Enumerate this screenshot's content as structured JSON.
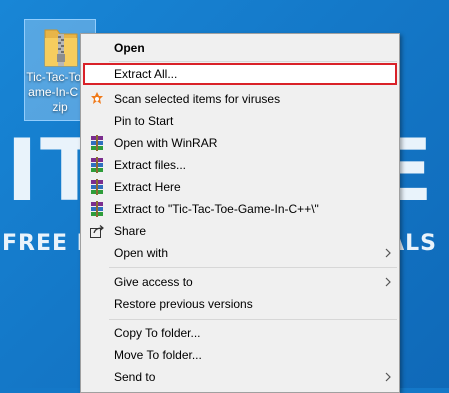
{
  "desktop": {
    "wallpaper_big_left": "IT S",
    "wallpaper_big_right": "E",
    "wallpaper_small_left": "FREE PRO",
    "wallpaper_small_right": "IALS"
  },
  "file": {
    "name": "Tic-Tac-Toe-Game-In-C++.zip",
    "label_visible": "Tic-Tac-To Game-In-C +.zip",
    "icon": "zip-folder-icon"
  },
  "context_menu": {
    "items": [
      {
        "label": "Open",
        "bold": true,
        "icon": ""
      },
      {
        "label": "Extract All...",
        "highlighted": true,
        "icon": ""
      },
      {
        "label": "Scan selected items for viruses",
        "icon": "avast-icon"
      },
      {
        "label": "Pin to Start",
        "icon": ""
      },
      {
        "label": "Open with WinRAR",
        "icon": "winrar-icon"
      },
      {
        "label": "Extract files...",
        "icon": "winrar-icon"
      },
      {
        "label": "Extract Here",
        "icon": "winrar-icon"
      },
      {
        "label": "Extract to \"Tic-Tac-Toe-Game-In-C++\\\"",
        "icon": "winrar-icon"
      },
      {
        "label": "Share",
        "icon": "share-icon"
      },
      {
        "label": "Open with",
        "submenu": true,
        "icon": ""
      },
      {
        "label": "Give access to",
        "submenu": true,
        "icon": ""
      },
      {
        "label": "Restore previous versions",
        "icon": ""
      },
      {
        "label": "Copy To folder...",
        "icon": ""
      },
      {
        "label": "Move To folder...",
        "icon": ""
      },
      {
        "label": "Send to",
        "submenu": true,
        "icon": ""
      }
    ]
  },
  "colors": {
    "wallpaper": "#1478c8",
    "menu_bg": "#f0f0f0",
    "highlight_border": "#d92128",
    "selection_bg": "#cce8ff"
  }
}
